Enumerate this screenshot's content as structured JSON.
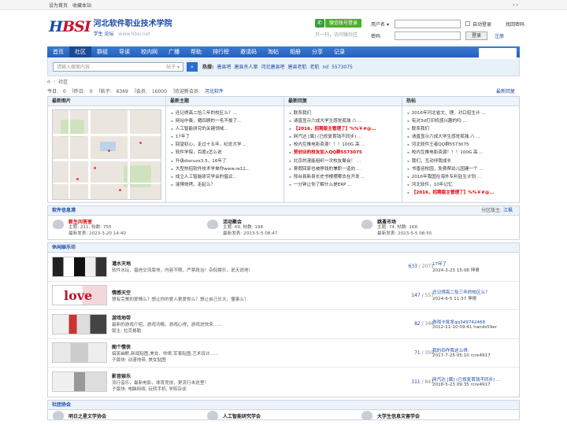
{
  "topbar": {
    "set_home": "设为首页",
    "bookmark": "收藏本站",
    "more": "‹ ›"
  },
  "logo": {
    "mark_a": "H",
    "mark_b": "BSI",
    "name": "河北软件职业技术学院",
    "sub": "学生 论坛",
    "url": "www.hbsi.net"
  },
  "wechat": {
    "label": "微信账号登录",
    "sub": "只一扫，访问微社区"
  },
  "login": {
    "user_label": "用户名",
    "pass_label": "密码",
    "remember": "自动登录",
    "forgot": "找回密码",
    "login_btn": "登录",
    "register": "注册",
    "user_select": "▾"
  },
  "nav": {
    "items": [
      "首页",
      "社区",
      "群组",
      "导读",
      "校内网",
      "广播",
      "帮助",
      "排行榜",
      "邀请码",
      "淘帖",
      "相册",
      "分享",
      "记录"
    ],
    "active_index": 1,
    "quick": "快捷导航 ▾"
  },
  "search": {
    "placeholder": "请输入搜索内容",
    "scope": "帖子 ▾",
    "hot_label": "热搜:",
    "hot": [
      "唐县吧",
      "唐县杀人案",
      "河北唐县吧",
      "唐县老航",
      "老航",
      "nd",
      "5573075"
    ]
  },
  "breadcrumb": {
    "home_icon": "⌂",
    "sep": "›",
    "current": "社区"
  },
  "stats": {
    "today_label": "今日:",
    "today": "0",
    "yest_label": "昨日:",
    "yest": "0",
    "posts_label": "帖子:",
    "posts": "6369",
    "members_label": "会员:",
    "members": "16000",
    "welcome": "欢迎新会员:",
    "new_member": "河北软件",
    "latest_reply": "最新回复"
  },
  "cols": {
    "pics": "最新图片",
    "topics": {
      "title": "最新主题",
      "items": [
        "还记得高二恰三年的校区么？...",
        "网站中奏，猪四顾的一毛不拔了...",
        "人工智能研究的关键领域...",
        "17年了",
        "回望初心，走过十五年，纪念大学...",
        "软件学院，百度z怎么说",
        "升级discuzx3.5，16年了",
        "大型热招软件技术学单你www.re12...",
        "成立人工智能研究学会的倡议...",
        "淄博烧烤，走起么？"
      ]
    },
    "replies": {
      "title": "最新回复",
      "items": [
        "联系我们",
        "请直显示六成大学生感觉孤独 八 ...",
        "【2016，招聘版主管理了】%%￥#@...",
        "网汽达 [属] (已修复首钱不同步) ...",
        "校内互推电影资源！！！100G 高 ...",
        "贸创业的校友加入QQ群5573075",
        "北京的漫能组织一次校友聚会！ ...",
        "寒假回家也被挣钱的兼职一道向 ...",
        "邢台县新县长史书楼摆哪去在开发 ...",
        "一分钟让你了解什么是ERP ..."
      ],
      "red": [
        2,
        5
      ]
    },
    "hot": {
      "title": "热帖",
      "items": [
        "2016年河北省文、理、对口招生计 ...",
        "有对3d打印机感兴趣的吗 ...",
        "联系我们",
        "请直显示六成大学生感觉孤独 八 ...",
        "河北软件王者QQ群5573075",
        "校内互推电影资源！！！100G 高 ...",
        "我们，互动伴我成长",
        "书香迎校园，免费帮幼儿园建一个 ...",
        "2016年我国在海外专利驻生计划 ...",
        "河北软件，10年记忆",
        "【2016，招聘版主管理了】%%￥#@..."
      ],
      "red": [
        10
      ]
    }
  },
  "sec1": {
    "title": "软件信息港",
    "right_label": "分区版主:",
    "right_name": "江枫",
    "forums": [
      {
        "name": "新生问答室",
        "stat": "主题: 211, 帖数: 755",
        "last": "最新发表: 2023-3-20 14:40",
        "red": true
      },
      {
        "name": "活动聚会",
        "stat": "主题: 69, 帖数: 198",
        "last": "最新发表: 2023-5-5 08:47",
        "red": false
      },
      {
        "name": "跳蚤市场",
        "stat": "主题: 74, 帖数: 168",
        "last": "最新发表: 2023-5-5 08:55",
        "red": false
      }
    ]
  },
  "sec2": {
    "title": "休闲娱乐坊",
    "rows": [
      {
        "name": "灌水天地",
        "desc": "软件水坛，倡信交流版块，内容不限，严禁政治！杂侃娱乐，说天说地！",
        "c1": "633",
        "c2": "2071",
        "lt": "17年了",
        "lm": "2024-3-23 15:08 坤哥"
      },
      {
        "name": "情感天空",
        "desc": "想有完美的爱情么？想让你的爱人更爱你么？想让自己长大，懂事么？",
        "c1": "147",
        "c2": "557",
        "lt": "还记得高二恰三年的校区么？",
        "lm": "2024-6-5 11:37 坤哥"
      },
      {
        "name": "游戏地带",
        "desc": "最新的游戏介绍，游戏功略，游戏心得，游戏进快来……",
        "c1": "82",
        "c2": "346",
        "lt": "游戏卡批发qq349742468",
        "lm": "2012-11-10 09:41 hands59er",
        "sub": "版主: 拉克格勒"
      },
      {
        "name": "图个情侠",
        "desc": "搞笑幽默,新闻贴图,美女、帅哥,军事贴图,艺术设计……",
        "c1": "71",
        "c2": "359",
        "lt": "我的旧咋我这么得.",
        "lm": "2017-7-25 05:10 rcre4917",
        "sub": "子版块: 动漫地带, 美女贴图"
      },
      {
        "name": "影音娱乐",
        "desc": "流行音乐，最新电影，体育竞技，更流行未这里！",
        "c1": "311",
        "c2": "841",
        "lt": "网汽达 [属] (已修复首钱不同步) ...",
        "lm": "2018-5-23 09:35 rcre4917",
        "sub": "子版块: 电脑网络, 玩转手机, 学院杂谈"
      }
    ]
  },
  "sec3": {
    "title": "社团协会",
    "forums": [
      "明日之星文学协会",
      "人工智能研究学会",
      "大学生信息灾害学会"
    ]
  }
}
